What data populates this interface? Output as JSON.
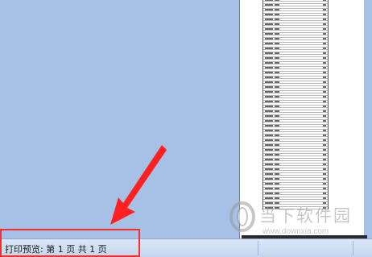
{
  "statusbar": {
    "text": "打印预览: 第 1 页  共 1 页"
  },
  "watermark": {
    "title": "当下软件园",
    "url": "www.downxia.com"
  },
  "colors": {
    "workspace": "#a7c1e6",
    "highlight": "#ff2a2a"
  },
  "icons": {
    "arrow": "red-arrow-icon",
    "watermark_logo": "watermark-logo-icon"
  }
}
